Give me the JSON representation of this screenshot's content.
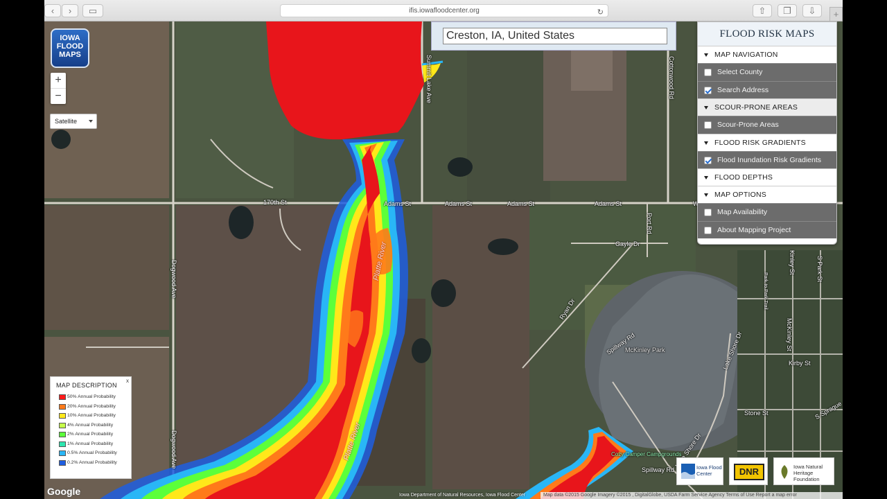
{
  "browser": {
    "url": "ifis.iowafloodcenter.org",
    "back_icon": "chevron-left",
    "forward_icon": "chevron-right",
    "reload_icon": "reload",
    "new_tab_label": "+"
  },
  "logo": {
    "line1": "IOWA",
    "line2": "FLOOD",
    "line3": "MAPS"
  },
  "zoom": {
    "in_label": "+",
    "out_label": "−"
  },
  "basemap": {
    "selected": "Satellite"
  },
  "search": {
    "value": "Creston, IA, United States"
  },
  "panel": {
    "title": "FLOOD RISK MAPS",
    "sections": [
      {
        "label": "MAP NAVIGATION",
        "items": [
          {
            "label": "Select County",
            "checked": false
          },
          {
            "label": "Search Address",
            "checked": true
          }
        ]
      },
      {
        "label": "SCOUR-PRONE AREAS",
        "items": [
          {
            "label": "Scour-Prone Areas",
            "checked": false
          }
        ]
      },
      {
        "label": "FLOOD RISK GRADIENTS",
        "items": [
          {
            "label": "Flood Inundation Risk Gradients",
            "checked": true
          }
        ]
      },
      {
        "label": "FLOOD DEPTHS",
        "items": []
      },
      {
        "label": "MAP OPTIONS",
        "items": [
          {
            "label": "Map Availability",
            "checked": false
          },
          {
            "label": "About Mapping Project",
            "checked": false
          }
        ]
      }
    ]
  },
  "legend": {
    "title": "MAP DESCRIPTION",
    "close": "x",
    "rows": [
      {
        "label": "50% Annual Probability",
        "color": "#ff1a1a"
      },
      {
        "label": "20% Annual Probability",
        "color": "#ff7a1a"
      },
      {
        "label": "10% Annual Probability",
        "color": "#ffe81a"
      },
      {
        "label": "4% Annual Probability",
        "color": "#c6ff4a"
      },
      {
        "label": "2% Annual Probability",
        "color": "#5cff3a"
      },
      {
        "label": "1% Annual Probability",
        "color": "#2ee6b0"
      },
      {
        "label": "0.5% Annual Probability",
        "color": "#29b6f6"
      },
      {
        "label": "0.2% Annual Probability",
        "color": "#1e5ee0"
      }
    ]
  },
  "map_labels": {
    "r1": "170th St",
    "r2": "Adams St",
    "r3": "Adams St",
    "r4": "Adams St",
    "r5": "Adams St",
    "r6": "Summit Lake Ave",
    "r7": "Cottonwood Rd",
    "r8": "Dogwood Ave",
    "r9": "Dogwood Ave",
    "r10": "Gayle Dr",
    "r11": "Port Rd",
    "r12": "Ryan Dr",
    "r13": "Spillway Rd",
    "r14": "McKinley Park",
    "r15": "Lake Shore Dr",
    "r16": "Lake Shore Dr",
    "r17": "Kirby St",
    "r18": "Stone St",
    "r19": "McKinley St",
    "r20": "S Park St",
    "r21": "Kinley St",
    "r22": "Park to Park Trail",
    "r23": "S Sprague",
    "r24": "Spillway Rd",
    "r25": "Cozy Camper Campgrounds",
    "r26": "W",
    "river1": "Platte River",
    "river2": "Platte River"
  },
  "google": "Google",
  "attribution": "Map data ©2015 Google Imagery ©2015 , DigitalGlobe, USDA Farm Service Agency   Terms of Use   Report a map error",
  "bottom_credit": "Iowa Department of Natural Resources, Iowa Flood Center",
  "partners": [
    {
      "label": "Iowa Flood Center"
    },
    {
      "label": "DNR"
    },
    {
      "label": "Iowa Natural Heritage Foundation"
    }
  ],
  "colors": {
    "flood_high": "#e8151b",
    "flood_orange": "#ff7a1a",
    "flood_yellow": "#ffe81a",
    "flood_green": "#5cff3a",
    "flood_blue": "#1e5ee0"
  }
}
